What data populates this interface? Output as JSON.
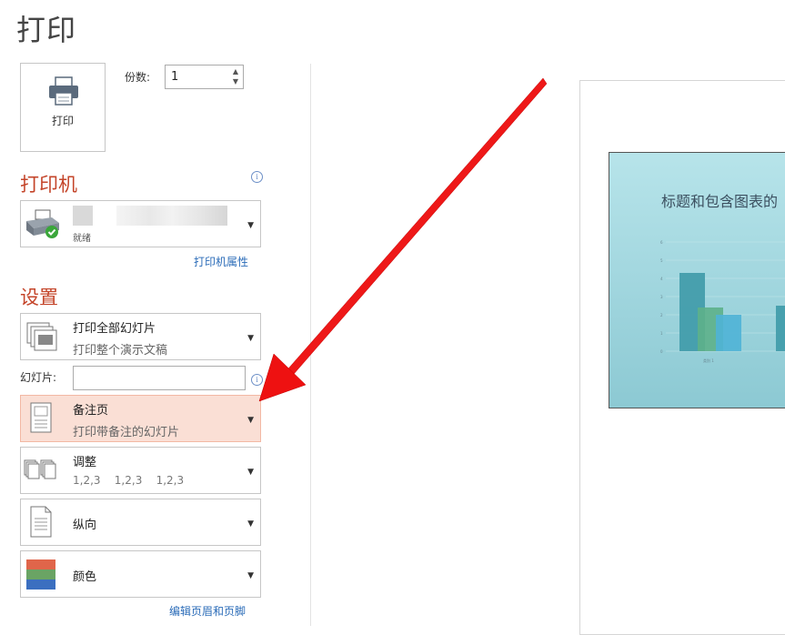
{
  "page_title": "打印",
  "print_button": {
    "label": "打印"
  },
  "copies": {
    "label": "份数:",
    "value": "1"
  },
  "printer": {
    "heading": "打印机",
    "status": "就绪",
    "properties_link": "打印机属性"
  },
  "settings": {
    "heading": "设置",
    "slides_label": "幻灯片:",
    "slides_value": "",
    "edit_header_footer_link": "编辑页眉和页脚",
    "options": [
      {
        "main": "打印全部幻灯片",
        "sub": "打印整个演示文稿",
        "icon": "slides-stack-icon"
      },
      {
        "main": "备注页",
        "sub": "打印带备注的幻灯片",
        "icon": "notes-page-icon",
        "selected": true
      },
      {
        "main": "调整",
        "sub": "1,2,3    1,2,3    1,2,3",
        "icon": "collate-icon"
      },
      {
        "main": "纵向",
        "sub": "",
        "icon": "portrait-icon"
      },
      {
        "main": "颜色",
        "sub": "",
        "icon": "color-icon"
      }
    ]
  },
  "preview": {
    "slide_title": "标题和包含图表的",
    "chart_data": {
      "type": "bar",
      "categories": [
        "类别 1",
        ""
      ],
      "series": [
        {
          "values": [
            4.3,
            2.5
          ]
        },
        {
          "values": [
            2.4,
            null
          ]
        },
        {
          "values": [
            2.0,
            null
          ]
        }
      ],
      "ylim": [
        0,
        6
      ],
      "yticks": [
        "0",
        "1",
        "2",
        "3",
        "4",
        "5",
        "6"
      ]
    }
  },
  "annotation": {
    "arrow_color": "#ee1111"
  },
  "colors": {
    "accent": "#c4452a",
    "link": "#2b6cb8",
    "selected_bg": "#fadfd5"
  }
}
